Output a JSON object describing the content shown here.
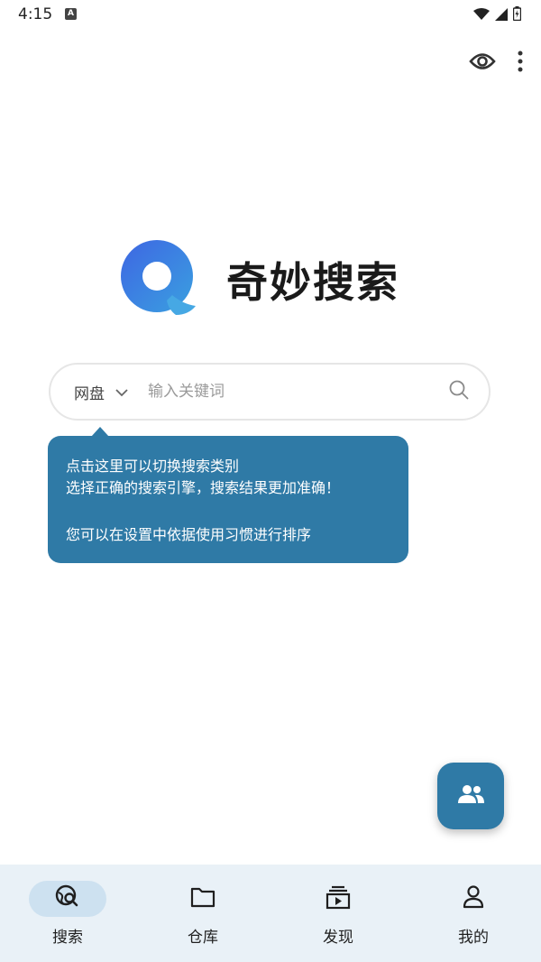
{
  "status_bar": {
    "time": "4:15",
    "notif_letter": "A"
  },
  "top_actions": {
    "icons": [
      "eye-icon",
      "more-vert-icon"
    ]
  },
  "brand": {
    "title": "奇妙搜索",
    "accent": "#3b6ee0"
  },
  "search": {
    "scope_label": "网盘",
    "placeholder": "输入关键词",
    "value": ""
  },
  "tooltip": {
    "line1": "点击这里可以切换搜索类别",
    "line2": "选择正确的搜索引擎，搜索结果更加准确！",
    "line3": "您可以在设置中依据使用习惯进行排序",
    "color": "#2f7aa6"
  },
  "fab": {
    "icon": "group-icon"
  },
  "bottom_nav": {
    "items": [
      {
        "label": "搜索",
        "icon": "search-globe-icon",
        "active": true
      },
      {
        "label": "仓库",
        "icon": "folder-icon",
        "active": false
      },
      {
        "label": "发现",
        "icon": "video-icon",
        "active": false
      },
      {
        "label": "我的",
        "icon": "person-icon",
        "active": false
      }
    ]
  }
}
